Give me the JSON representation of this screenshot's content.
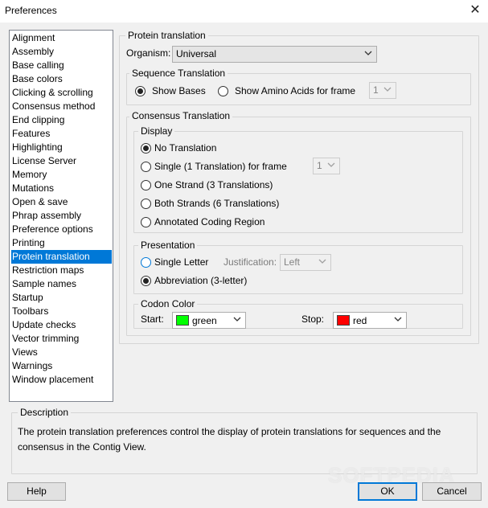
{
  "window": {
    "title": "Preferences",
    "close_glyph": "✕"
  },
  "sidebar": {
    "items": [
      "Alignment",
      "Assembly",
      "Base calling",
      "Base colors",
      "Clicking & scrolling",
      "Consensus method",
      "End clipping",
      "Features",
      "Highlighting",
      "License Server",
      "Memory",
      "Mutations",
      "Open & save",
      "Phrap assembly",
      "Preference options",
      "Printing",
      "Protein translation",
      "Restriction maps",
      "Sample names",
      "Startup",
      "Toolbars",
      "Update checks",
      "Vector trimming",
      "Views",
      "Warnings",
      "Window placement"
    ],
    "selected": "Protein translation"
  },
  "protein_translation": {
    "group_label": "Protein translation",
    "organism_label": "Organism:",
    "organism_value": "Universal"
  },
  "sequence_translation": {
    "group_label": "Sequence Translation",
    "show_bases": "Show Bases",
    "show_amino": "Show Amino Acids for frame",
    "frame_value": "1",
    "selected": "Show Bases"
  },
  "consensus_translation": {
    "group_label": "Consensus Translation",
    "display": {
      "group_label": "Display",
      "options": [
        "No Translation",
        "Single (1 Translation) for frame",
        "One Strand (3 Translations)",
        "Both Strands (6 Translations)",
        "Annotated Coding Region"
      ],
      "selected": "No Translation",
      "frame_value": "1"
    },
    "presentation": {
      "group_label": "Presentation",
      "single_letter": "Single Letter",
      "justification_label": "Justification:",
      "justification_value": "Left",
      "abbreviation": "Abbreviation (3-letter)",
      "selected": "Abbreviation (3-letter)"
    },
    "codon_color": {
      "group_label": "Codon Color",
      "start_label": "Start:",
      "start_value": "green",
      "start_color": "#00ff00",
      "stop_label": "Stop:",
      "stop_value": "red",
      "stop_color": "#ff0000"
    }
  },
  "description": {
    "label": "Description",
    "text": "The protein translation preferences control the display of protein translations for sequences and the consensus in the Contig View."
  },
  "buttons": {
    "help": "Help",
    "ok": "OK",
    "cancel": "Cancel"
  },
  "watermark": "SOFTPEDIA"
}
